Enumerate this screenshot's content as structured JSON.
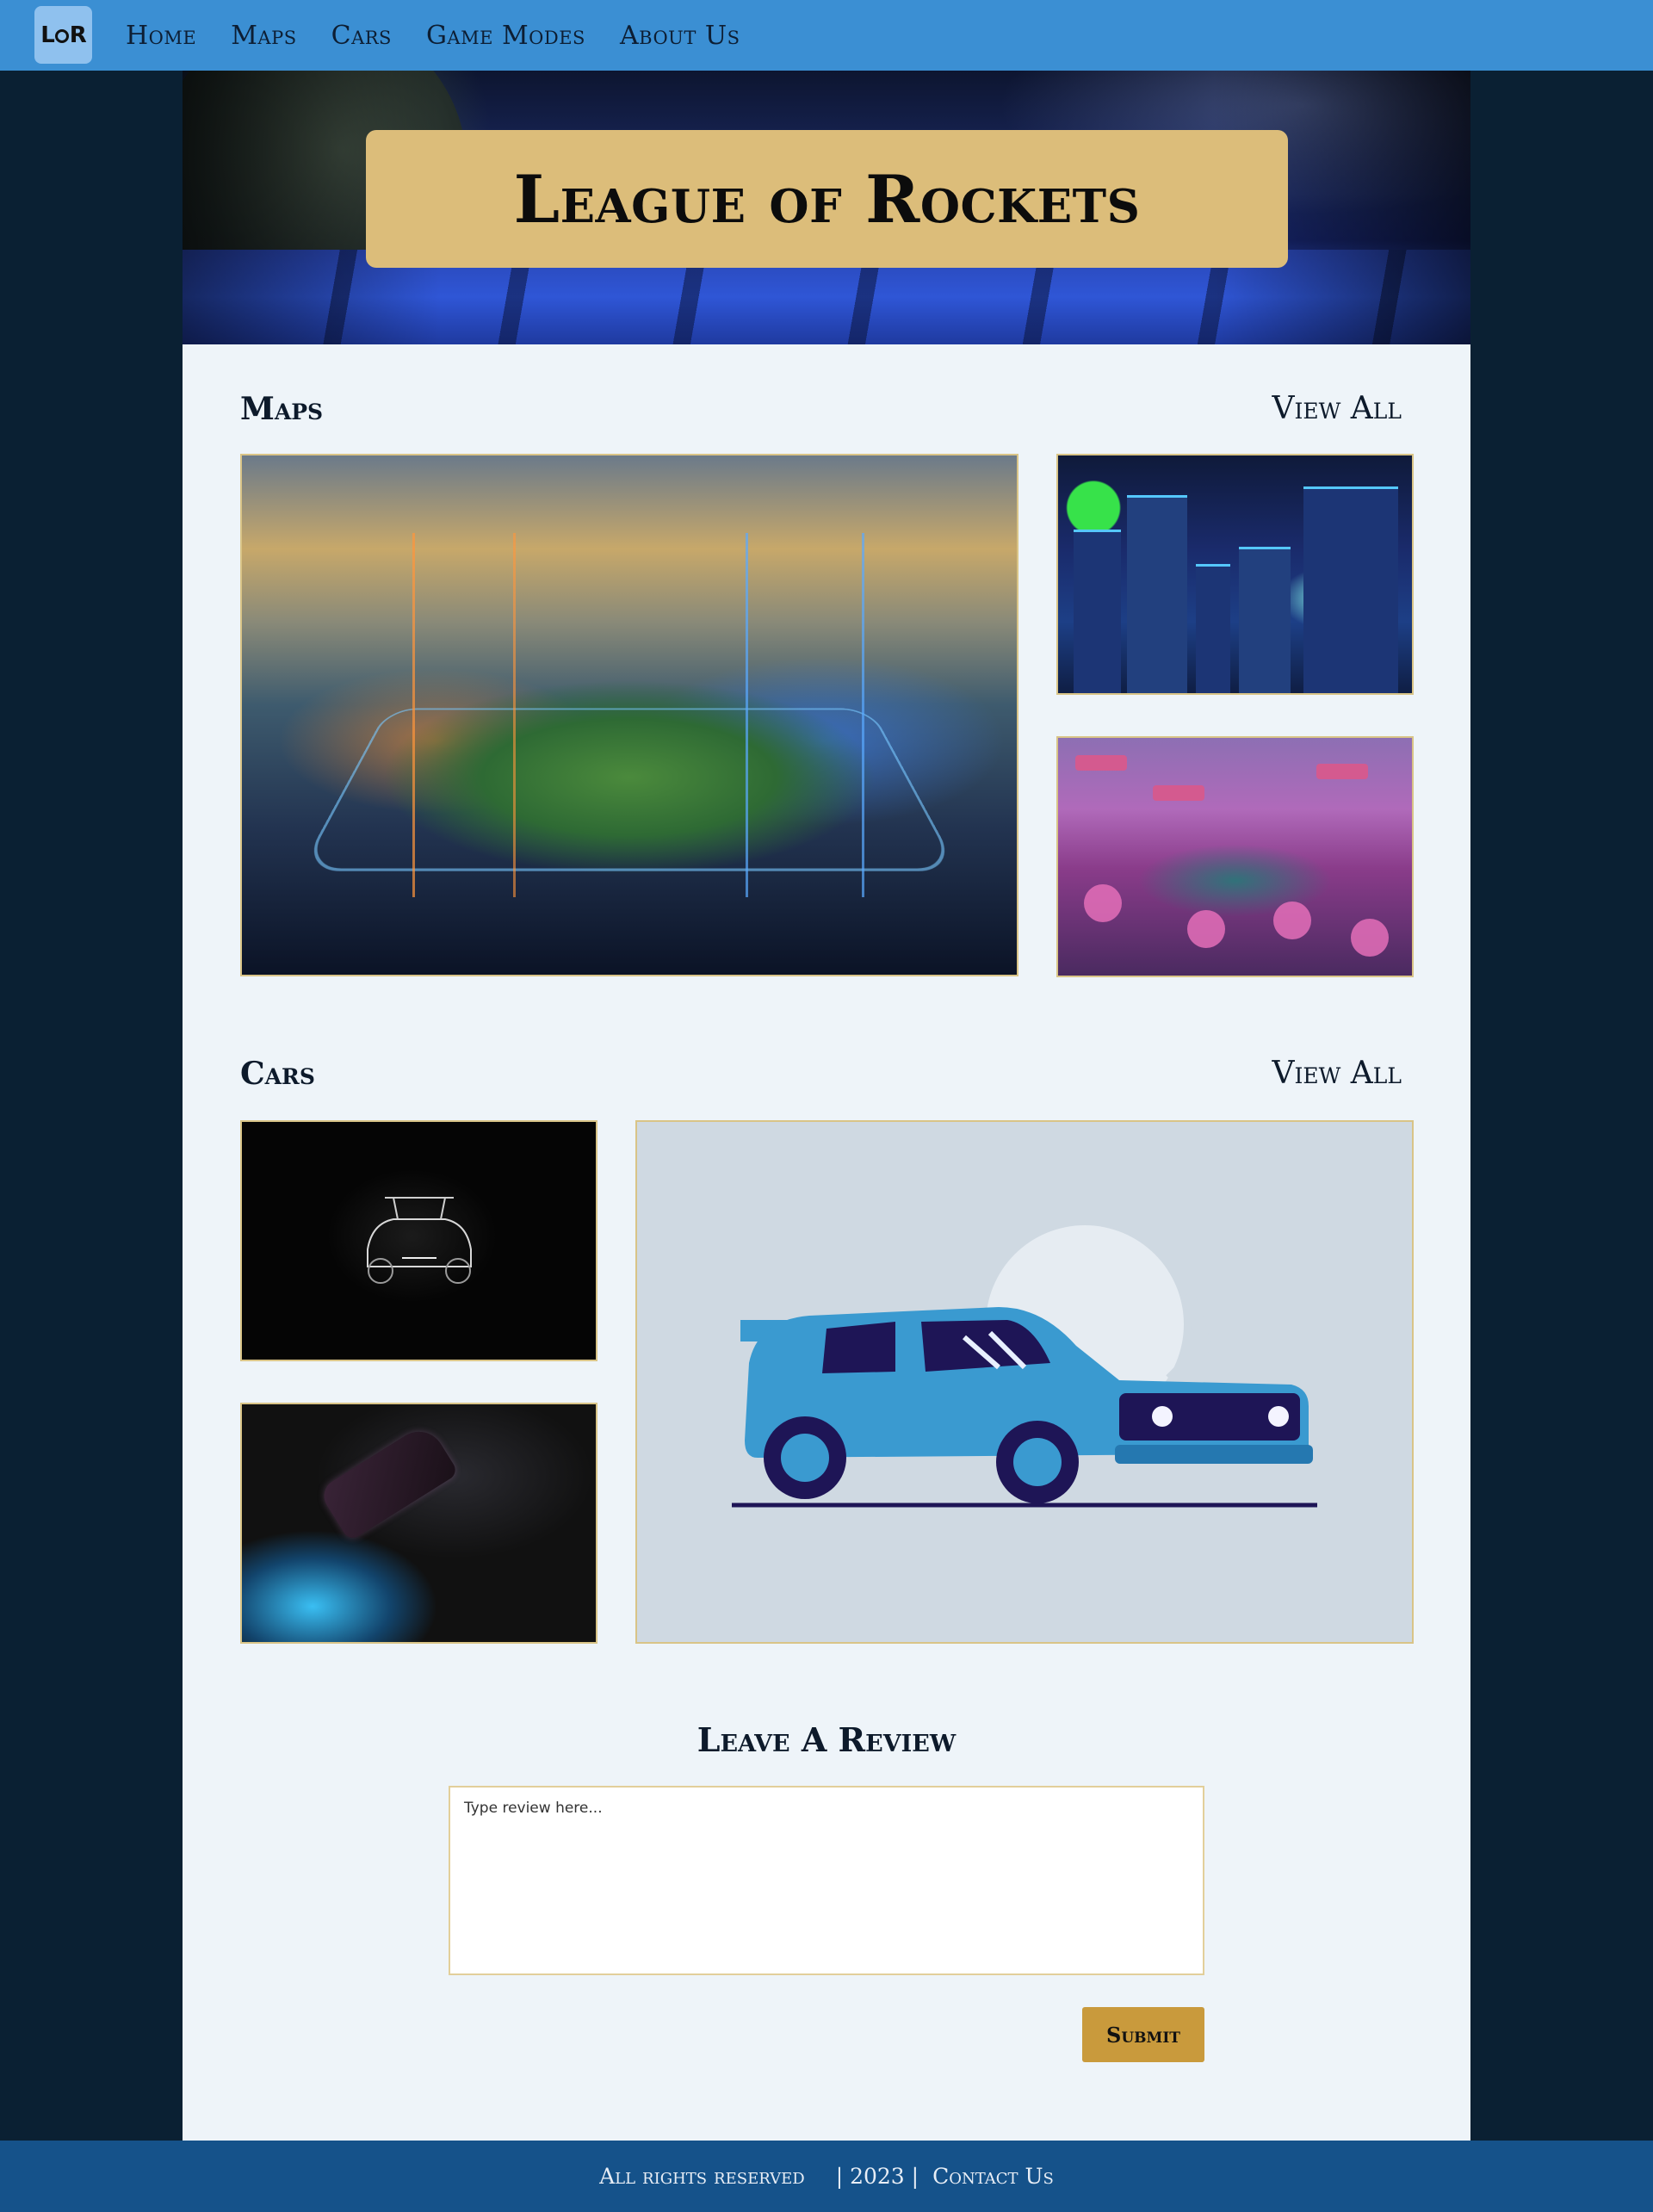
{
  "nav": {
    "logo_text": "LoR",
    "links": [
      "Home",
      "Maps",
      "Cars",
      "Game Modes",
      "About Us"
    ]
  },
  "hero": {
    "title": "League of Rockets"
  },
  "maps_section": {
    "heading": "Maps",
    "view_all": "View All"
  },
  "cars_section": {
    "heading": "Cars",
    "view_all": "View All"
  },
  "review": {
    "heading": "Leave A Review",
    "placeholder": "Type review here...",
    "submit_label": "Submit"
  },
  "footer": {
    "rights": "All rights reserved",
    "year": "| 2023 |",
    "contact": "Contact Us"
  },
  "colors": {
    "nav_bg": "#3b8fd3",
    "page_bg": "#0a2033",
    "content_bg": "#eef4f9",
    "banner_gold": "#dcbd7a",
    "submit_gold": "#c99a3c",
    "footer_bg": "#15528a"
  }
}
